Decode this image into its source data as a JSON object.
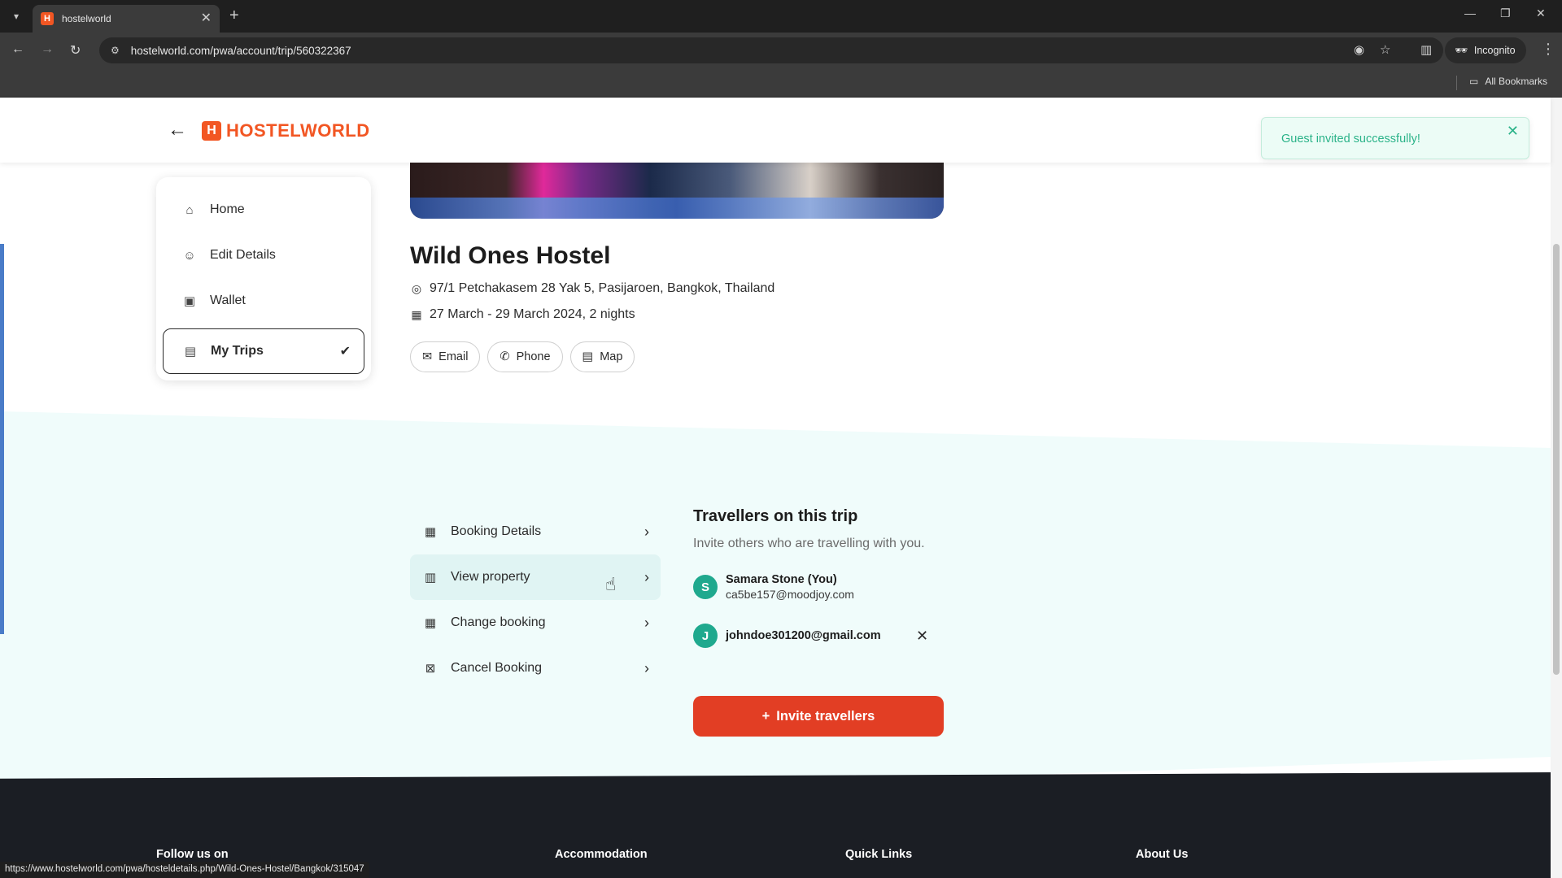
{
  "browser": {
    "tab_title": "hostelworld",
    "url": "hostelworld.com/pwa/account/trip/560322367",
    "incognito_label": "Incognito",
    "bookmarks_label": "All Bookmarks",
    "status_url": "https://www.hostelworld.com/pwa/hosteldetails.php/Wild-Ones-Hostel/Bangkok/315047"
  },
  "header": {
    "logo_text": "HOSTELWORLD"
  },
  "toast": {
    "message": "Guest invited successfully!"
  },
  "sidebar": {
    "items": [
      {
        "label": "Home",
        "icon": "home-icon"
      },
      {
        "label": "Edit Details",
        "icon": "user-icon"
      },
      {
        "label": "Wallet",
        "icon": "wallet-icon"
      },
      {
        "label": "My Trips",
        "icon": "map-icon",
        "active": true
      }
    ]
  },
  "property": {
    "name": "Wild Ones Hostel",
    "address": "97/1 Petchakasem 28 Yak 5, Pasijaroen, Bangkok, Thailand",
    "dates": "27 March - 29 March 2024, 2 nights",
    "contacts": [
      {
        "label": "Email",
        "icon": "mail-icon"
      },
      {
        "label": "Phone",
        "icon": "phone-icon"
      },
      {
        "label": "Map",
        "icon": "map-icon"
      }
    ]
  },
  "actions": [
    {
      "label": "Booking Details",
      "icon": "calendar-icon"
    },
    {
      "label": "View property",
      "icon": "building-icon"
    },
    {
      "label": "Change booking",
      "icon": "calendar-edit-icon"
    },
    {
      "label": "Cancel Booking",
      "icon": "calendar-x-icon"
    }
  ],
  "travellers": {
    "title": "Travellers on this trip",
    "subtitle": "Invite others who are travelling with you.",
    "guests": [
      {
        "initial": "S",
        "name": "Samara Stone (You)",
        "email": "ca5be157@moodjoy.com"
      },
      {
        "initial": "J",
        "name": "johndoe301200@gmail.com"
      }
    ],
    "invite_label": "Invite travellers"
  },
  "footer": {
    "headings": [
      "Follow us on",
      "Accommodation",
      "Quick Links",
      "About Us"
    ]
  },
  "colors": {
    "brand": "#f25623",
    "cta": "#e23e24",
    "avatar": "#1fa98e",
    "toast_text": "#2bb389",
    "band": "#f0fcfb"
  }
}
